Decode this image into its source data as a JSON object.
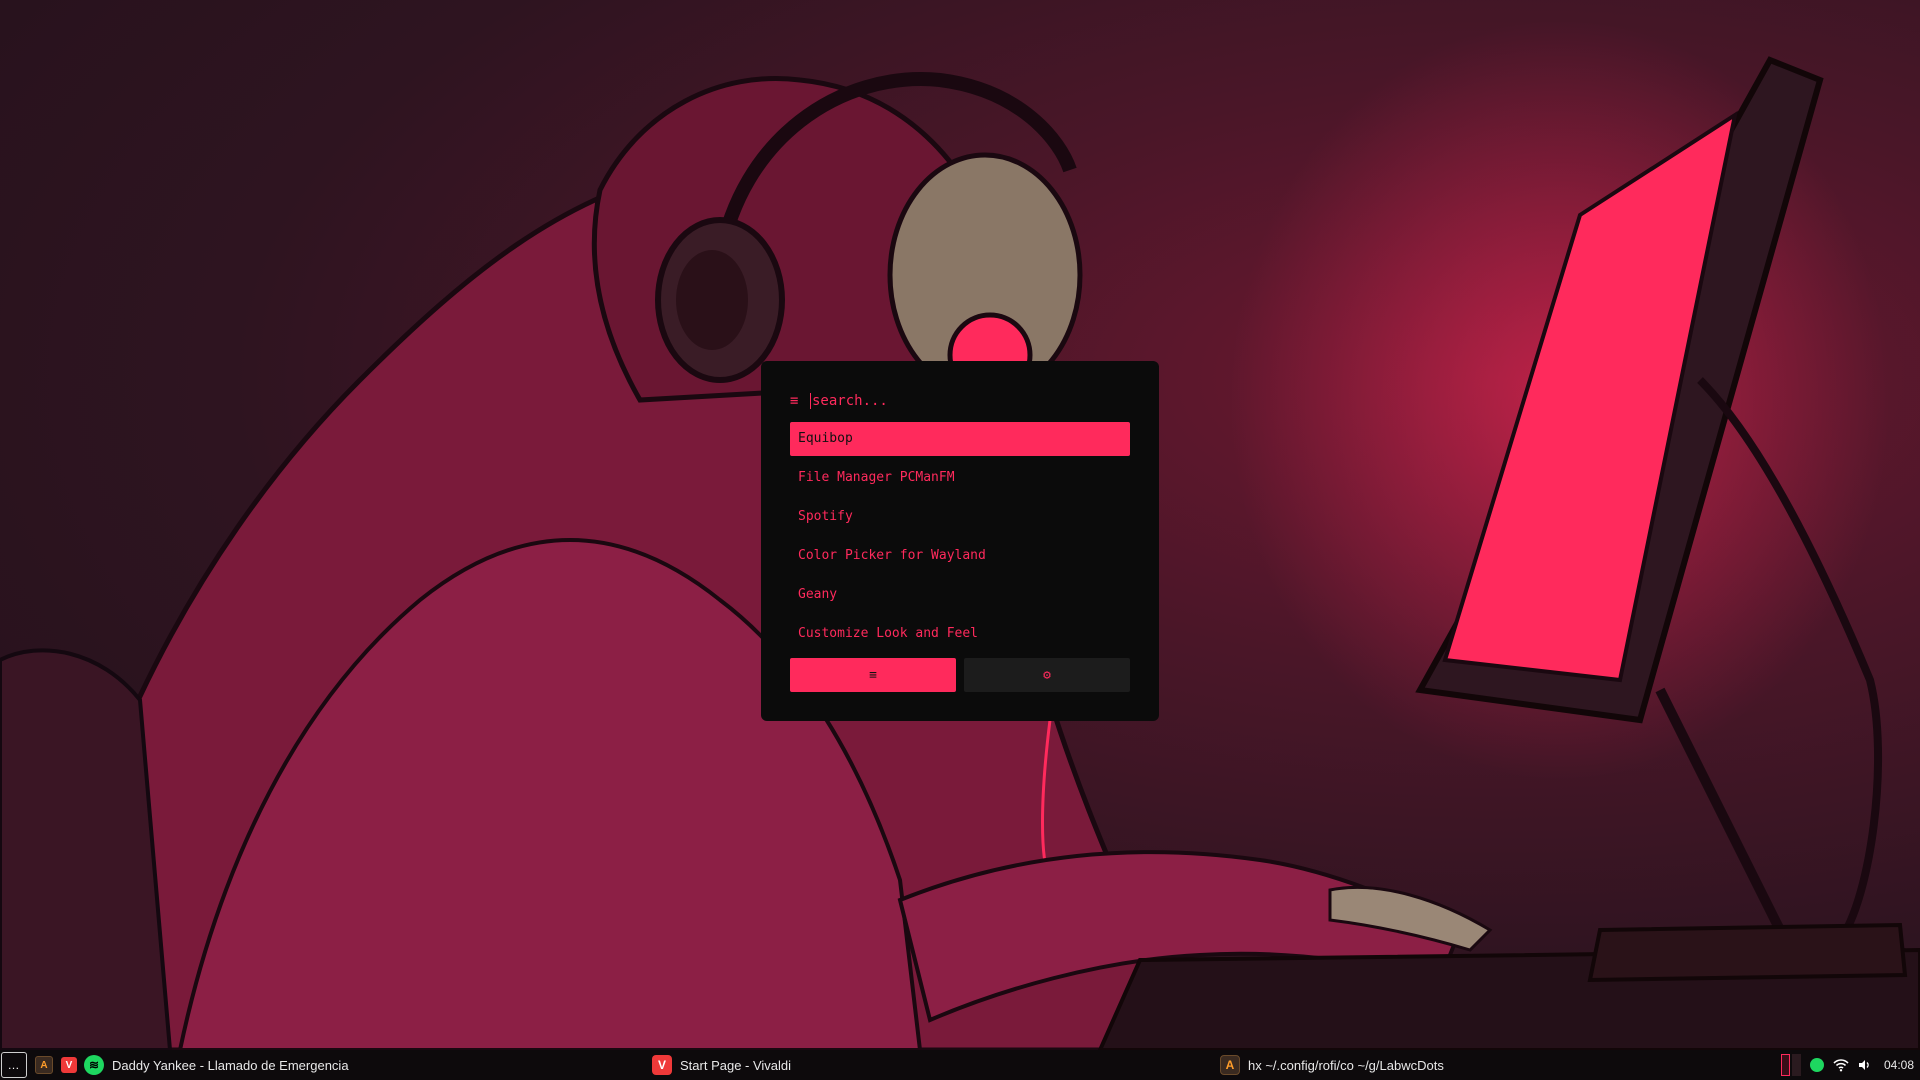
{
  "launcher": {
    "search_placeholder": "search...",
    "search_icon": "menu-icon",
    "apps": [
      {
        "label": "Equibop",
        "selected": true
      },
      {
        "label": "File Manager PCManFM",
        "selected": false
      },
      {
        "label": "Spotify",
        "selected": false
      },
      {
        "label": "Color Picker for Wayland",
        "selected": false
      },
      {
        "label": "Geany",
        "selected": false
      },
      {
        "label": "Customize Look and Feel",
        "selected": false
      }
    ],
    "modes": [
      {
        "icon": "≡",
        "name": "drun-mode",
        "active": true
      },
      {
        "icon": "⚙",
        "name": "settings-mode",
        "active": false
      }
    ],
    "accent_color": "#ff2a5c"
  },
  "panel": {
    "menu_label": "…",
    "launchers": [
      {
        "name": "foot-terminal-icon",
        "glyph": "A"
      },
      {
        "name": "vivaldi-icon",
        "glyph": "V"
      }
    ],
    "tasks": [
      {
        "title": "Daddy Yankee - Llamado de Emergencia",
        "icon": "spotify-icon"
      },
      {
        "title": "Start Page - Vivaldi",
        "icon": "vivaldi-icon"
      },
      {
        "title": "hx ~/.config/rofi/co ~/g/LabwcDots",
        "icon": "terminal-icon"
      }
    ],
    "clock": "04:08"
  }
}
